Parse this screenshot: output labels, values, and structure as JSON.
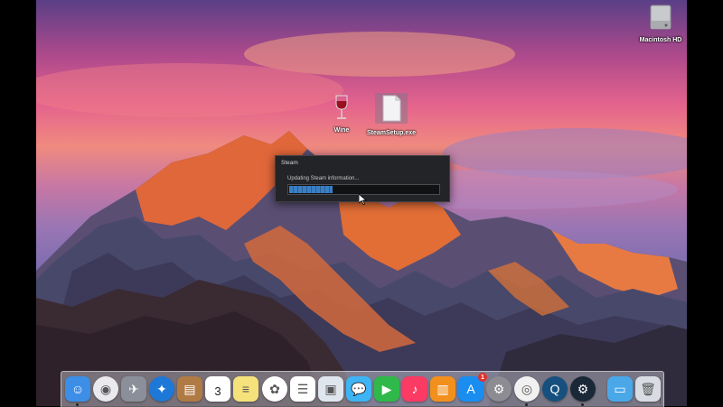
{
  "desktop": {
    "icons": [
      {
        "label": "Macintosh HD",
        "icon": "hard-drive-icon"
      },
      {
        "label": "Wine",
        "icon": "wine-glass-icon"
      },
      {
        "label": "SteamSetup.exe",
        "icon": "document-icon"
      }
    ]
  },
  "steam_window": {
    "title": "Steam",
    "status": "Updating Steam information...",
    "progress": 0.29
  },
  "dock": {
    "items": [
      {
        "icon": "finder-icon",
        "color": "#3c8ee6",
        "running": true
      },
      {
        "icon": "siri-icon",
        "color": "#e9e9ee"
      },
      {
        "icon": "launchpad-icon",
        "color": "#8a8f99"
      },
      {
        "icon": "safari-icon",
        "color": "#1e78d7"
      },
      {
        "icon": "contacts-icon",
        "color": "#b07a45"
      },
      {
        "icon": "calendar-icon",
        "color": "#ffffff",
        "text": "3"
      },
      {
        "icon": "notes-icon",
        "color": "#f6e27a"
      },
      {
        "icon": "photos-icon",
        "color": "#ffffff"
      },
      {
        "icon": "reminders-icon",
        "color": "#ffffff"
      },
      {
        "icon": "preview-icon",
        "color": "#dfe6ee"
      },
      {
        "icon": "messages-icon",
        "color": "#3fb4f5"
      },
      {
        "icon": "facetime-icon",
        "color": "#2fb94a"
      },
      {
        "icon": "music-icon",
        "color": "#fb3b63"
      },
      {
        "icon": "ibooks-icon",
        "color": "#f2901e"
      },
      {
        "icon": "app-store-icon",
        "color": "#1a8df0",
        "badge": "1"
      },
      {
        "icon": "system-preferences-icon",
        "color": "#8c8c92"
      },
      {
        "icon": "chrome-icon",
        "color": "#f1f1f1",
        "running": true
      },
      {
        "icon": "quicktime-icon",
        "color": "#17507e"
      },
      {
        "icon": "steam-icon",
        "color": "#1b2838",
        "running": true
      },
      {
        "icon": "folder-icon",
        "color": "#4aa8e8"
      },
      {
        "icon": "trash-icon",
        "color": "#d9dde3"
      }
    ]
  }
}
